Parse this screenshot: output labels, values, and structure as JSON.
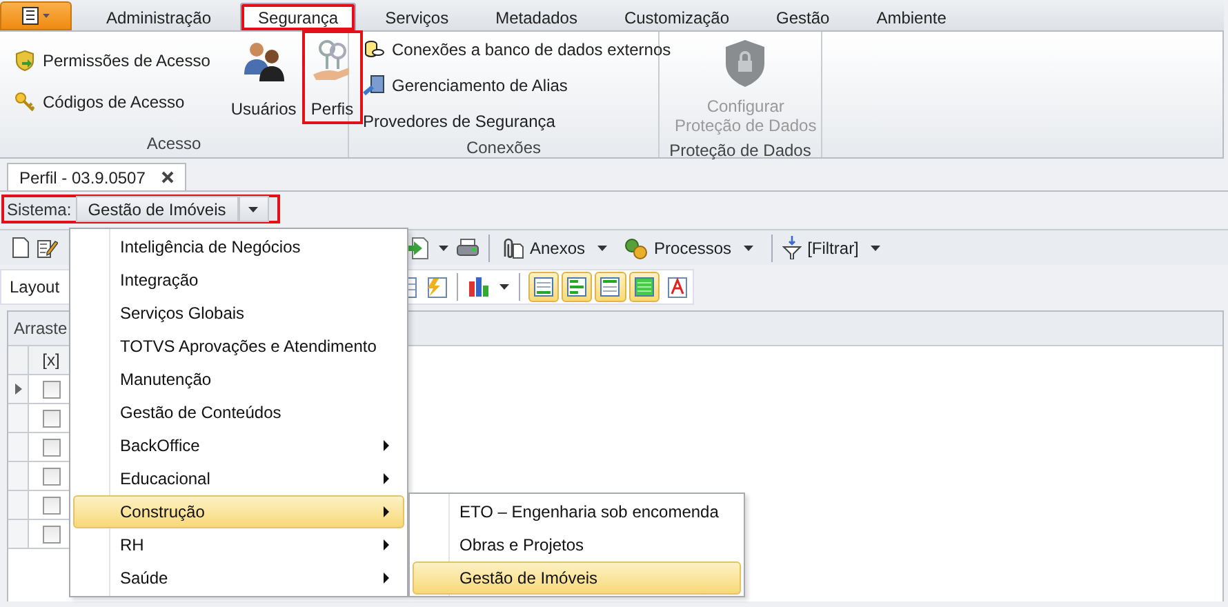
{
  "ribbon": {
    "tabs": [
      {
        "label": "Administração",
        "selected": false,
        "highlighted": false
      },
      {
        "label": "Segurança",
        "selected": true,
        "highlighted": true
      },
      {
        "label": "Serviços",
        "selected": false,
        "highlighted": false
      },
      {
        "label": "Metadados",
        "selected": false,
        "highlighted": false
      },
      {
        "label": "Customização",
        "selected": false,
        "highlighted": false
      },
      {
        "label": "Gestão",
        "selected": false,
        "highlighted": false
      },
      {
        "label": "Ambiente",
        "selected": false,
        "highlighted": false
      }
    ],
    "groups": [
      {
        "title": "Acesso",
        "items": [
          {
            "kind": "small",
            "label": "Permissões de Acesso",
            "disabled": false,
            "highlighted": false
          },
          {
            "kind": "small",
            "label": "Códigos de Acesso",
            "disabled": false,
            "highlighted": false
          },
          {
            "kind": "large",
            "label": "Usuários",
            "disabled": false,
            "highlighted": false
          },
          {
            "kind": "large",
            "label": "Perfis",
            "disabled": false,
            "highlighted": true
          }
        ]
      },
      {
        "title": "Conexões",
        "items": [
          {
            "kind": "small",
            "label": "Conexões a banco de dados externos",
            "disabled": false,
            "highlighted": false
          },
          {
            "kind": "small",
            "label": "Gerenciamento de Alias",
            "disabled": false,
            "highlighted": false
          },
          {
            "kind": "text",
            "label": "Provedores de Segurança",
            "disabled": false,
            "highlighted": false
          }
        ]
      },
      {
        "title": "Proteção de Dados",
        "items": [
          {
            "kind": "large",
            "label": "Configurar\nProteção de Dados",
            "disabled": true,
            "highlighted": false
          }
        ]
      }
    ]
  },
  "document_tab": {
    "title": "Perfil - 03.9.0507"
  },
  "system_bar": {
    "label": "Sistema:",
    "value": "Gestão de Imóveis",
    "highlighted": true
  },
  "toolbar": {
    "buttons": [
      "Anexos",
      "Processos",
      "[Filtrar]"
    ]
  },
  "view_toolbar": {
    "label": "Layout",
    "layout_buttons": [
      {
        "selected": true
      },
      {
        "selected": true
      },
      {
        "selected": true
      },
      {
        "selected": true
      },
      {
        "selected": false
      }
    ]
  },
  "grid": {
    "group_panel": "Arraste",
    "columns": [
      "[x]"
    ],
    "rows": [
      {
        "current": true,
        "checked": false
      },
      {
        "current": false,
        "checked": false
      },
      {
        "current": false,
        "checked": false
      },
      {
        "current": false,
        "checked": false
      },
      {
        "current": false,
        "checked": false
      },
      {
        "current": false,
        "checked": false
      }
    ]
  },
  "system_menu": {
    "items": [
      {
        "label": "Inteligência de Negócios",
        "submenu": false,
        "selected": false
      },
      {
        "label": "Integração",
        "submenu": false,
        "selected": false
      },
      {
        "label": "Serviços Globais",
        "submenu": false,
        "selected": false
      },
      {
        "label": "TOTVS Aprovações e Atendimento",
        "submenu": false,
        "selected": false
      },
      {
        "label": "Manutenção",
        "submenu": false,
        "selected": false
      },
      {
        "label": "Gestão de Conteúdos",
        "submenu": false,
        "selected": false
      },
      {
        "label": "BackOffice",
        "submenu": true,
        "selected": false
      },
      {
        "label": "Educacional",
        "submenu": true,
        "selected": false
      },
      {
        "label": "Construção",
        "submenu": true,
        "selected": true
      },
      {
        "label": "RH",
        "submenu": true,
        "selected": false
      },
      {
        "label": "Saúde",
        "submenu": true,
        "selected": false
      }
    ]
  },
  "submenu": {
    "items": [
      {
        "label": "ETO – Engenharia sob encomenda",
        "selected": false
      },
      {
        "label": "Obras e Projetos",
        "selected": false
      },
      {
        "label": "Gestão de Imóveis",
        "selected": true
      }
    ]
  }
}
